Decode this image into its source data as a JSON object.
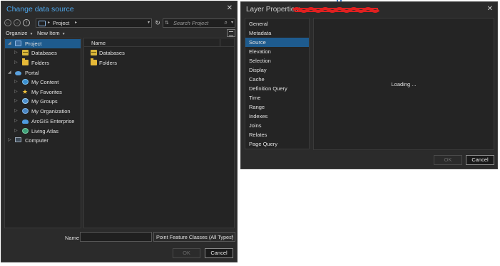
{
  "change_data_source": {
    "title": "Change data source",
    "close_glyph": "✕",
    "nav": {
      "back_glyph": "←",
      "forward_glyph": "→",
      "up_glyph": "↑"
    },
    "path": {
      "separator_glyph": "▸",
      "current": "Project",
      "next_glyph": "▸",
      "dropdown_glyph": "▾"
    },
    "refresh_glyph": "↻",
    "search": {
      "sort_glyph": "⇅",
      "placeholder": "Search Project",
      "icon_glyph": "⌕",
      "dropdown_glyph": "▾"
    },
    "toolbar": {
      "organize_label": "Organize",
      "organize_caret": "▼",
      "new_item_label": "New Item",
      "new_item_caret": "▼"
    },
    "tree": {
      "project": {
        "label": "Project",
        "expander": "◢"
      },
      "databases": {
        "label": "Databases",
        "expander": "▷"
      },
      "folders": {
        "label": "Folders",
        "expander": "▷"
      },
      "portal": {
        "label": "Portal",
        "expander": "◢"
      },
      "my_content": {
        "label": "My Content",
        "expander": "▷"
      },
      "my_favorites": {
        "label": "My Favorites",
        "expander": "▷",
        "icon_glyph": "★"
      },
      "my_groups": {
        "label": "My Groups",
        "expander": "▷"
      },
      "my_organization": {
        "label": "My Organization",
        "expander": "▷"
      },
      "arcgis_enterprise": {
        "label": "ArcGIS Enterprise",
        "expander": "▷"
      },
      "living_atlas": {
        "label": "Living Atlas",
        "expander": "▷"
      },
      "computer": {
        "label": "Computer",
        "expander": "▷"
      }
    },
    "content": {
      "column_name": "Name",
      "items": {
        "databases": "Databases",
        "folders": "Folders"
      }
    },
    "name_label": "Name",
    "name_value": "",
    "type_filter": {
      "selected": "Point Feature Classes (All Types)",
      "arrow": "▾"
    },
    "ok_label": "OK",
    "cancel_label": "Cancel"
  },
  "layer_properties": {
    "title": "Layer Properties:",
    "close_glyph": "✕",
    "redaction_color": "#e02020",
    "nav_items": {
      "general": "General",
      "metadata": "Metadata",
      "source": "Source",
      "elevation": "Elevation",
      "selection": "Selection",
      "display": "Display",
      "cache": "Cache",
      "definition_query": "Definition Query",
      "time": "Time",
      "range": "Range",
      "indexes": "Indexes",
      "joins": "Joins",
      "relates": "Relates",
      "page_query": "Page Query"
    },
    "selected_item": "Source",
    "loading_text": "Loading ...",
    "ok_label": "OK",
    "cancel_label": "Cancel"
  },
  "colors": {
    "dialog_bg": "#2b2b2b",
    "selection": "#1e5b8e",
    "title_accent": "#4ea6ea"
  }
}
